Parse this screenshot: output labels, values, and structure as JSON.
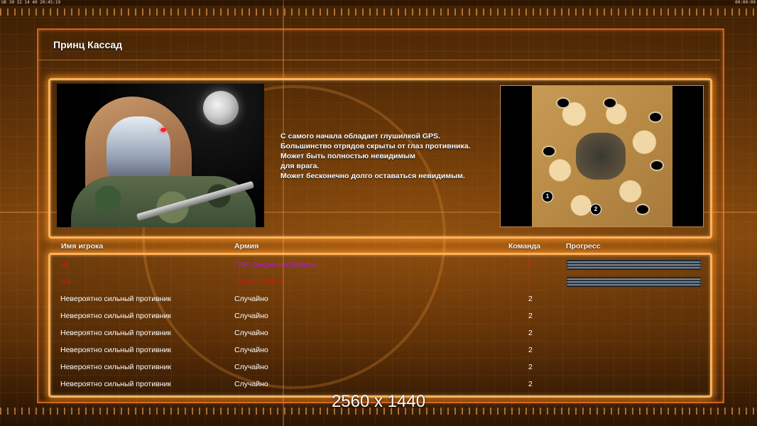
{
  "status_bar": {
    "left": "UK 30 32 14 40 20:45:19",
    "right": "00:00:00"
  },
  "title": "Принц Кассад",
  "description_lines": [
    "С самого начала обладает глушилкой GPS.",
    "Большинство отрядов скрыты от глаз противника.",
    "Может быть полностью невидимым",
    "для врага.",
    "Может бесконечно долго оставаться невидимым."
  ],
  "minimap": {
    "start_positions": [
      "1",
      "2"
    ]
  },
  "table": {
    "headers": {
      "name": "Имя игрока",
      "army": "Армия",
      "team": "Команда",
      "progress": "Прогресс"
    },
    "rows": [
      {
        "name": "Hi",
        "army": "ГЛА: Секретные Войска",
        "team": "1",
        "name_color": "#d11818",
        "army_color": "#b319d6",
        "team_color": "#d11818",
        "progress": 1.0
      },
      {
        "name": "SS",
        "army": "Китай: Пехота",
        "team": "1",
        "name_color": "#e01212",
        "army_color": "#e01212",
        "team_color": "#e01212",
        "progress": 1.0
      },
      {
        "name": "Невероятно сильный противник",
        "army": "Случайно",
        "team": "2",
        "name_color": "#ffffff",
        "army_color": "#ffffff",
        "team_color": "#ffffff"
      },
      {
        "name": "Невероятно сильный противник",
        "army": "Случайно",
        "team": "2",
        "name_color": "#ffffff",
        "army_color": "#ffffff",
        "team_color": "#ffffff"
      },
      {
        "name": "Невероятно сильный противник",
        "army": "Случайно",
        "team": "2",
        "name_color": "#ffffff",
        "army_color": "#ffffff",
        "team_color": "#ffffff"
      },
      {
        "name": "Невероятно сильный противник",
        "army": "Случайно",
        "team": "2",
        "name_color": "#ffffff",
        "army_color": "#ffffff",
        "team_color": "#ffffff"
      },
      {
        "name": "Невероятно сильный противник",
        "army": "Случайно",
        "team": "2",
        "name_color": "#ffffff",
        "army_color": "#ffffff",
        "team_color": "#ffffff"
      },
      {
        "name": "Невероятно сильный противник",
        "army": "Случайно",
        "team": "2",
        "name_color": "#ffffff",
        "army_color": "#ffffff",
        "team_color": "#ffffff"
      }
    ]
  },
  "resolution_label": "2560 x 1440",
  "colors": {
    "accent": "#ffb25a",
    "background": "#8a4a0c"
  }
}
